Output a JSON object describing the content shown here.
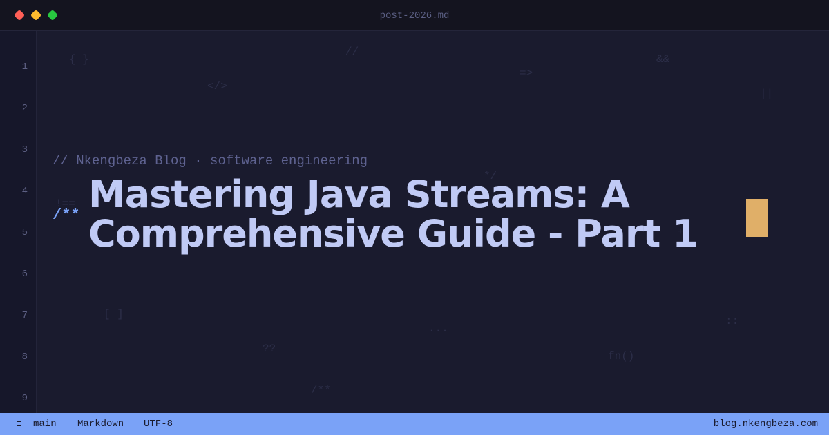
{
  "titlebar": {
    "filename": "post-2026.md"
  },
  "gutter": {
    "line_numbers": [
      "1",
      "2",
      "3",
      "4",
      "5",
      "6",
      "7",
      "8",
      "9"
    ]
  },
  "decorations": [
    "{ }",
    "//",
    "=>",
    "&&",
    "</>",
    "||",
    "*/",
    "!==",
    "++",
    "[ ]",
    "...",
    "::",
    "??",
    "fn()",
    "/**"
  ],
  "editor": {
    "comment": "// Nkengbeza Blog · software engineering",
    "doc_open": "/**",
    "title": "Mastering Java Streams: A Comprehensive Guide - Part 1"
  },
  "statusbar": {
    "branch_icon": "branch-icon",
    "branch": "main",
    "language": "Markdown",
    "encoding": "UTF-8",
    "site": "blog.nkengbeza.com"
  },
  "colors": {
    "background": "#1a1b2e",
    "accent": "#7aa2f7",
    "title": "#c0caf5",
    "cursor": "#e0af68"
  }
}
